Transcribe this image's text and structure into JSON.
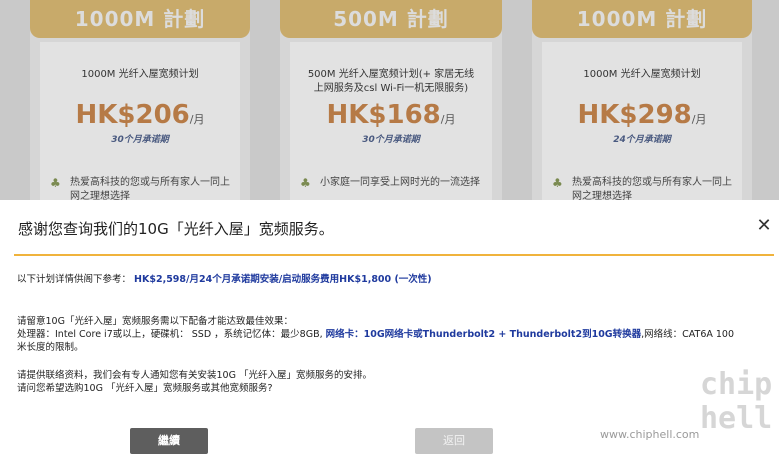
{
  "plans": [
    {
      "header": "1000M 計劃",
      "name": "1000M 光纤入屋宽频计划",
      "price": "HK$206",
      "unit": "/月",
      "term": "30个月承诺期",
      "desc": "热爱高科技的您或与所有家人一同上网之理想选择"
    },
    {
      "header": "500M 計劃",
      "name": "500M 光纤入屋宽频计划(+ 家居无线上网服务及csl Wi-Fi一机无限服务)",
      "price": "HK$168",
      "unit": "/月",
      "term": "30个月承诺期",
      "desc": "小家庭一同享受上网时光的一流选择"
    },
    {
      "header": "1000M 計劃",
      "name": "1000M 光纤入屋宽频计划",
      "price": "HK$298",
      "unit": "/月",
      "term": "24个月承诺期",
      "desc": "热爱高科技的您或与所有家人一同上网之理想选择"
    }
  ],
  "modal": {
    "title": "感谢您查询我们的10G「光纤入屋」宽频服务。",
    "close_glyph": "✕",
    "line1_prefix": "以下计划详情供阁下参考：",
    "line1_highlight": "HK$2,598/月24个月承诺期安装/启动服务费用HK$1,800 (一次性)",
    "line2": "请留意10G「光纤入屋」宽频服务需以下配备才能达致最佳效果：",
    "line3_prefix": "处理器：Intel Core i7或以上，硬碟机： SSD ，系统记忆体：最少8GB, ",
    "line3_highlight": "网络卡：10G网络卡或Thunderbolt2 + Thunderbolt2到10G转换器",
    "line3_suffix": ",网络线：CAT6A 100",
    "line4": "米长度的限制。",
    "line5": "请提供联络资料，我们会有专人通知您有关安装10G 「光纤入屋」宽频服务的安排。",
    "line6": "请问您希望选购10G 「光纤入屋」宽频服务或其他宽频服务?",
    "continue_label": "繼續",
    "back_label": "返回"
  },
  "watermark": {
    "logo_text": "chip hell",
    "url": "www.chiphell.com"
  },
  "colors": {
    "accent_rule": "#f0b33c",
    "highlight_blue": "#1f3a9e",
    "price": "#b67a46"
  },
  "icons": {
    "family": "family-icon",
    "close": "close-icon"
  }
}
